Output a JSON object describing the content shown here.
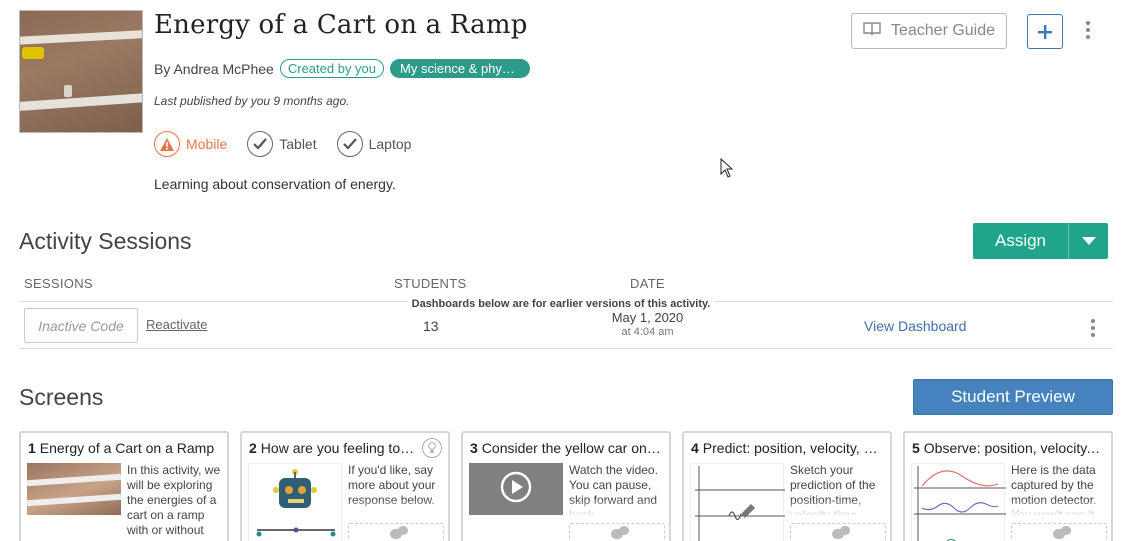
{
  "activity": {
    "title": "Energy of a Cart on a Ramp",
    "by": "By Andrea McPhee",
    "created_badge": "Created by you",
    "collection_badge": "My science & physics",
    "published": "Last published by you 9 months ago.",
    "description": "Learning about conservation of energy.",
    "devices": [
      {
        "label": "Mobile",
        "status": "warning"
      },
      {
        "label": "Tablet",
        "status": "ok"
      },
      {
        "label": "Laptop",
        "status": "ok"
      }
    ]
  },
  "toolbar": {
    "teacher_guide": "Teacher Guide",
    "add_icon": "plus-icon"
  },
  "sessions": {
    "title": "Activity Sessions",
    "assign_label": "Assign",
    "columns": {
      "sessions": "SESSIONS",
      "students": "STUDENTS",
      "date": "DATE"
    },
    "notice": "Dashboards below are for earlier versions of this activity.",
    "rows": [
      {
        "code": "Inactive Code",
        "action": "Reactivate",
        "students": "13",
        "date": "May 1, 2020",
        "time": "at 4:04 am",
        "link": "View Dashboard"
      }
    ]
  },
  "screens": {
    "title": "Screens",
    "preview_label": "Student Preview",
    "cards": [
      {
        "num": "1",
        "title": "Energy of a Cart on a Ramp",
        "text": "In this activity, we will be exploring the energies of a cart on a ramp with or without"
      },
      {
        "num": "2",
        "title": "How are you feeling today?",
        "text": "If you'd like, say more about your response below."
      },
      {
        "num": "3",
        "title": "Consider the yellow car on the ramp",
        "text": "Watch the video. You can pause, skip forward and back."
      },
      {
        "num": "4",
        "title": "Predict: position, velocity, and energy",
        "text": "Sketch your prediction of the position-time, velocity-time graphs."
      },
      {
        "num": "5",
        "title": "Observe: position, velocity, and energy",
        "text": "Here is the data captured by the motion detector. You won't see it"
      }
    ]
  },
  "colors": {
    "accent_green": "#20a48b",
    "accent_blue": "#4682be",
    "warning": "#e8764b",
    "badge_teal": "#2f9a8a"
  }
}
